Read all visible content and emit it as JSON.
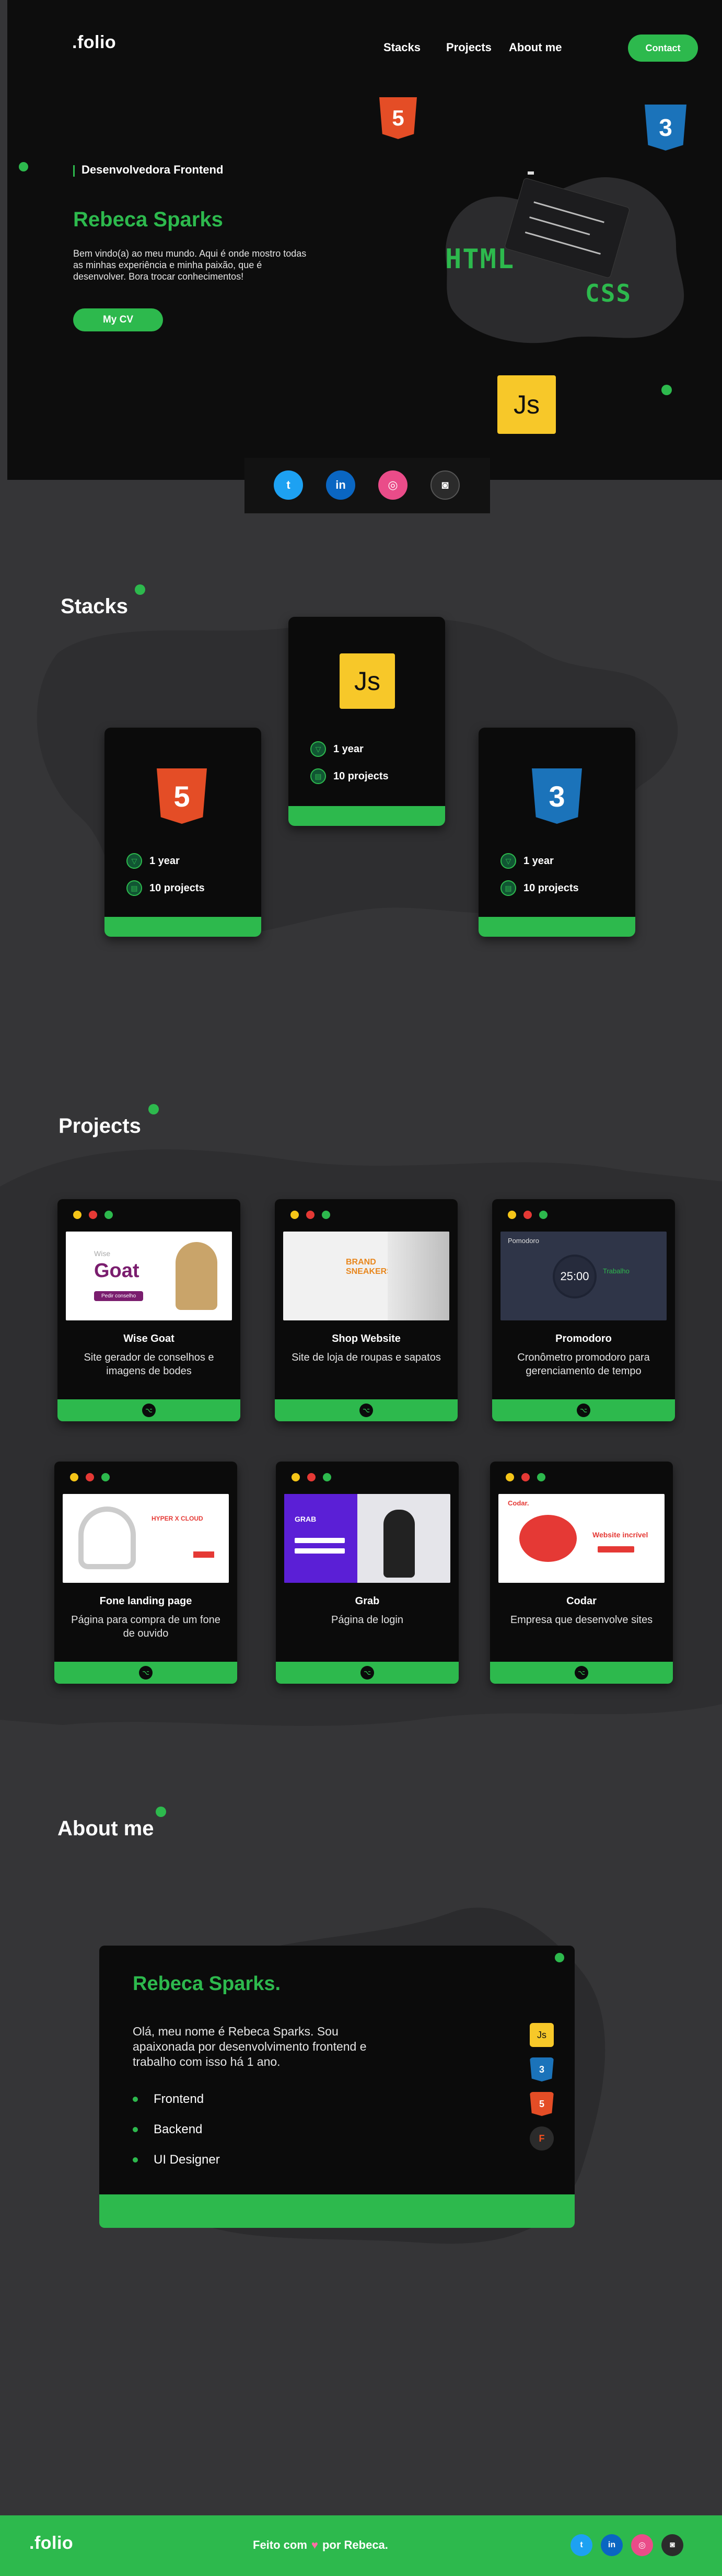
{
  "header": {
    "logo": ".folio",
    "nav": [
      "Stacks",
      "Projects",
      "About me"
    ],
    "contact_label": "Contact"
  },
  "hero": {
    "subtitle": "Desenvolvedora Frontend",
    "name": "Rebeca Sparks",
    "text": "Bem vindo(a) ao meu mundo. Aqui é onde mostro todas as minhas experiência e minha paixão, que é desenvolver. Bora trocar conhecimentos!",
    "cta_label": "My CV",
    "badges": {
      "html5": "5",
      "css3": "3",
      "js": "Js",
      "html_word": "HTML",
      "css_word": "CSS"
    }
  },
  "social": [
    {
      "name": "twitter",
      "glyph": "t",
      "color": "#1da1f2"
    },
    {
      "name": "linkedin",
      "glyph": "in",
      "color": "#0a66c2"
    },
    {
      "name": "dribbble",
      "glyph": "◎",
      "color": "#ea4c89"
    },
    {
      "name": "instagram",
      "glyph": "◙",
      "color": "#2b2b2b"
    }
  ],
  "stacks": {
    "title": "Stacks",
    "cards": [
      {
        "tech": "HTML5",
        "badge": "5",
        "time": "1 year",
        "projects": "10 projects"
      },
      {
        "tech": "JavaScript",
        "badge": "Js",
        "time": "1 year",
        "projects": "10 projects"
      },
      {
        "tech": "CSS3",
        "badge": "3",
        "time": "1 year",
        "projects": "10 projects"
      }
    ]
  },
  "projects": {
    "title": "Projects",
    "items": [
      {
        "name": "Wise Goat",
        "desc": "Site gerador de conselhos e imagens de bodes",
        "shot": {
          "brand": "Wise",
          "title": "Goat",
          "btn": "Pedir conselho"
        }
      },
      {
        "name": "Shop Website",
        "desc": "Site de loja de roupas e sapatos",
        "shot": {
          "title": "BRAND SNEAKERS"
        }
      },
      {
        "name": "Promodoro",
        "desc": "Cronômetro promodoro para gerenciamento de tempo",
        "shot": {
          "label": "Pomodoro",
          "time": "25:00",
          "mode": "Trabalho"
        }
      },
      {
        "name": "Fone landing page",
        "desc": "Página para compra de um fone de ouvido",
        "shot": {
          "title": "HYPER X CLOUD"
        }
      },
      {
        "name": "Grab",
        "desc": "Página de login",
        "shot": {
          "brand": "GRAB"
        }
      },
      {
        "name": "Codar",
        "desc": "Empresa que desenvolve sites",
        "shot": {
          "brand": "Codar.",
          "headline": "Website incrível"
        }
      }
    ]
  },
  "about": {
    "title": "About me",
    "name": "Rebeca Sparks.",
    "text": "Olá, meu nome é Rebeca Sparks. Sou apaixonada por desenvolvimento frontend e trabalho com isso há 1 ano.",
    "skills": [
      "Frontend",
      "Backend",
      "UI Designer"
    ],
    "mini_icons": [
      "Js",
      "3",
      "5",
      "F"
    ]
  },
  "footer": {
    "logo": ".folio",
    "made_with_prefix": "Feito com",
    "made_with_suffix": "por Rebeca."
  },
  "colors": {
    "accent": "#2db94d",
    "dark": "#0d0d0d",
    "bg": "#353537",
    "js": "#f7c829",
    "html": "#e44d26",
    "css": "#1b73ba"
  }
}
